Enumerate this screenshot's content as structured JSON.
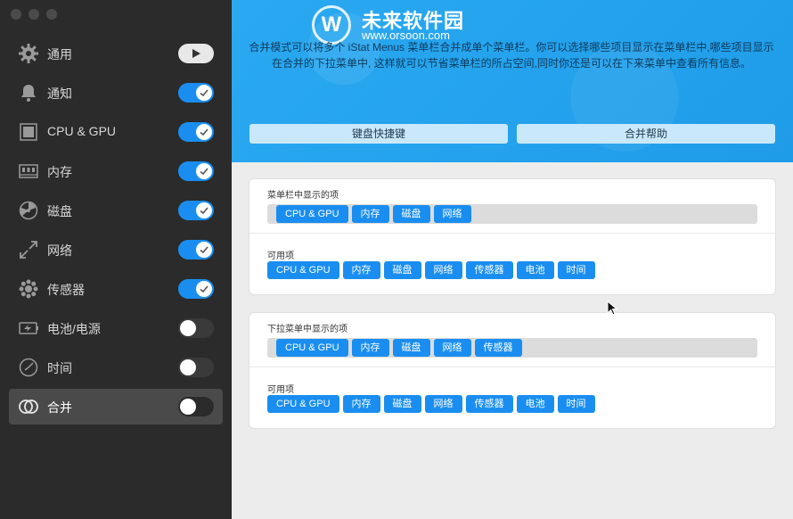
{
  "sidebar": {
    "items": [
      {
        "label": "通用",
        "icon": "gear-icon",
        "control": "play"
      },
      {
        "label": "通知",
        "icon": "bell-icon",
        "control": "on"
      },
      {
        "label": "CPU & GPU",
        "icon": "cpu-icon",
        "control": "on"
      },
      {
        "label": "内存",
        "icon": "memory-icon",
        "control": "on"
      },
      {
        "label": "磁盘",
        "icon": "disk-icon",
        "control": "on"
      },
      {
        "label": "网络",
        "icon": "network-arrows-icon",
        "control": "on"
      },
      {
        "label": "传感器",
        "icon": "sensor-icon",
        "control": "on"
      },
      {
        "label": "电池/电源",
        "icon": "battery-icon",
        "control": "off"
      },
      {
        "label": "时间",
        "icon": "clock-icon",
        "control": "off"
      },
      {
        "label": "合并",
        "icon": "combine-rings-icon",
        "control": "off",
        "selected": true
      }
    ]
  },
  "watermark": {
    "title": "未来软件园",
    "url": "www.orsoon.com"
  },
  "banner": {
    "description": "合并模式可以将多个 iStat Menus 菜单栏合并成单个菜单栏。你可以选择哪些项目显示在菜单栏中,哪些项目显示在合并的下拉菜单中, 这样就可以节省菜单栏的所占空间,同时你还是可以在下来菜单中查看所有信息。",
    "buttons": [
      "键盘快捷键",
      "合并帮助"
    ]
  },
  "menubar_panel": {
    "shown_label": "菜单栏中显示的项",
    "shown": [
      "CPU & GPU",
      "内存",
      "磁盘",
      "网络"
    ],
    "available_label": "可用项",
    "available": [
      "CPU & GPU",
      "内存",
      "磁盘",
      "网络",
      "传感器",
      "电池",
      "时间"
    ]
  },
  "dropdown_panel": {
    "shown_label": "下拉菜单中显示的项",
    "shown": [
      "CPU & GPU",
      "内存",
      "磁盘",
      "网络",
      "传感器"
    ],
    "available_label": "可用项",
    "available": [
      "CPU & GPU",
      "内存",
      "磁盘",
      "网络",
      "传感器",
      "电池",
      "时间"
    ]
  },
  "colors": {
    "accent": "#1a8ef0",
    "banner": "#27a6ef",
    "sidebar": "#2b2b2b"
  }
}
